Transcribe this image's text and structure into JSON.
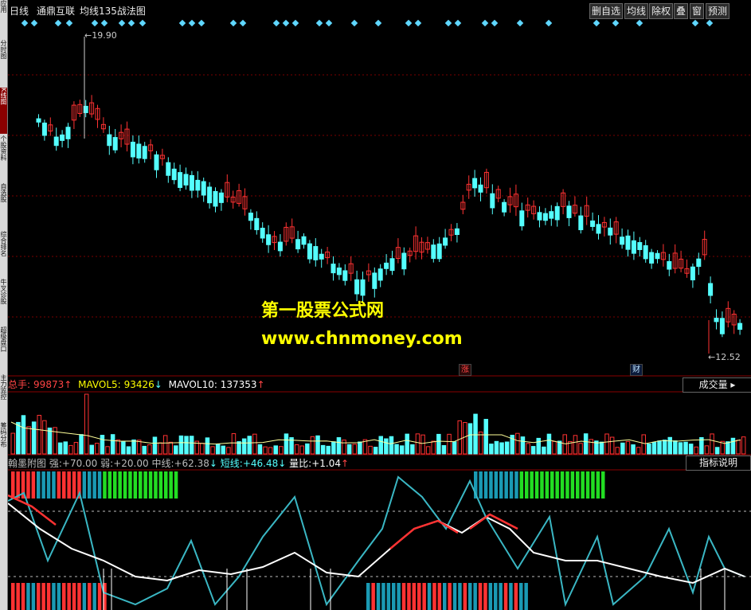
{
  "window": {
    "period": "日线",
    "stock_name": "通鼎互联",
    "indicator_name": "均线135战法图",
    "buttons": [
      "删自选",
      "均线",
      "除权",
      "叠",
      "窗",
      "预测"
    ]
  },
  "left_tabs": [
    "应用",
    "分时图",
    "K线图",
    "个股资料",
    "自选股",
    "综合排名",
    "牛叉诊股",
    "超级盘口",
    "主力监控",
    "筹码分布"
  ],
  "price_chart": {
    "high_label": "19.90",
    "low_label": "12.52",
    "event_tags": [
      "涨",
      "财"
    ]
  },
  "watermark": {
    "line1": "第一股票公式网",
    "line2": "www.chnmoney.com"
  },
  "volume_panel": {
    "label_total": "总手:",
    "total_value": "99873",
    "total_arrow": "↑",
    "label_ma5": "MAVOL5:",
    "ma5_value": "93426",
    "ma5_arrow": "↓",
    "label_ma10": "MAVOL10:",
    "ma10_value": "137353",
    "ma10_arrow": "↑",
    "selector": "成交量"
  },
  "indicator_panel": {
    "name": "翰墨附图",
    "strong_label": "强:",
    "strong_value": "+70.00",
    "weak_label": "弱:",
    "weak_value": "+20.00",
    "mid_label": "中线:",
    "mid_value": "+62.38",
    "mid_arrow": "↓",
    "short_label": "短线:",
    "short_value": "+46.48",
    "short_arrow": "↓",
    "ratio_label": "量比:",
    "ratio_value": "+1.04",
    "ratio_arrow": "↑",
    "help_button": "指标说明"
  },
  "colors": {
    "up": "#ff3232",
    "down": "#54ffff",
    "grid": "#7a0000",
    "yellow": "#ffff00",
    "bull_bar": "#22dd22",
    "mid_bar": "#1aa3b8"
  }
}
